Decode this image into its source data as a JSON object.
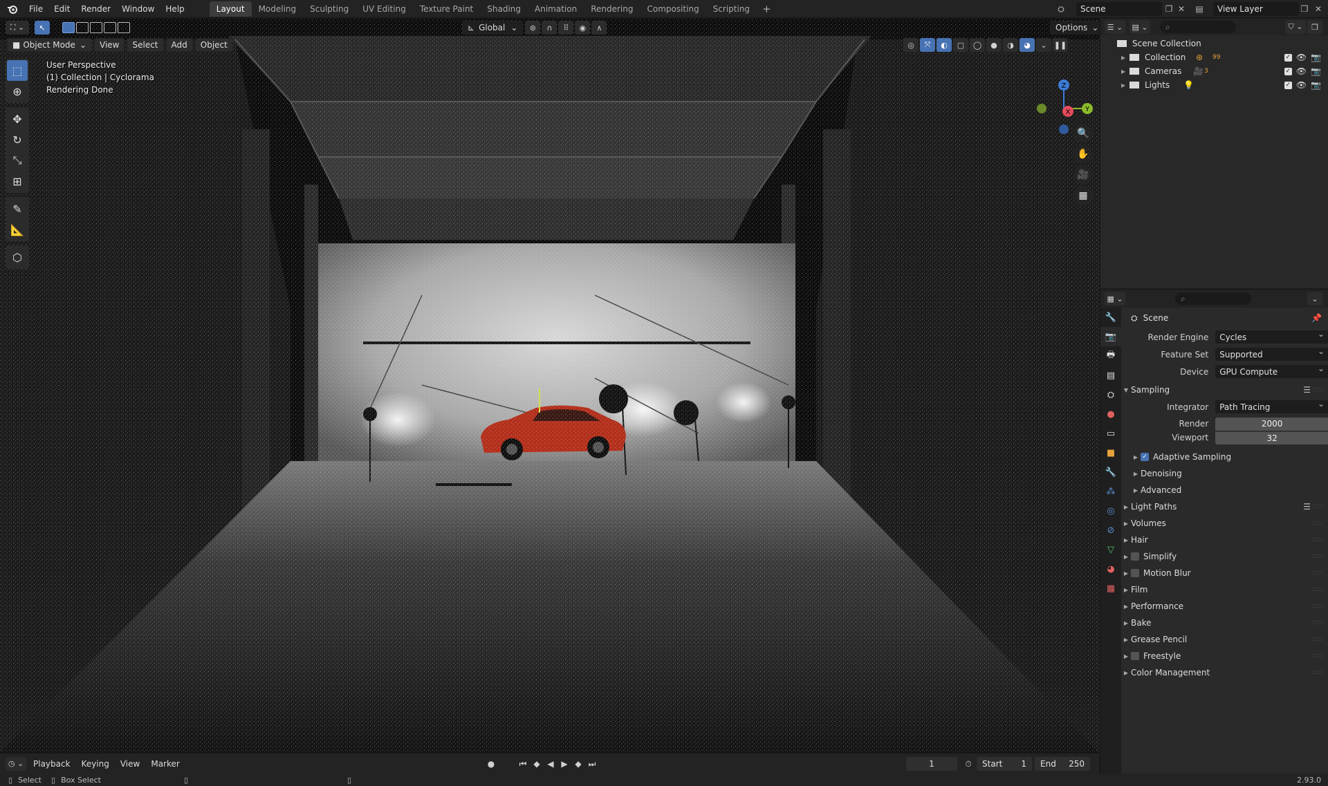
{
  "topbar": {
    "menus": [
      "File",
      "Edit",
      "Render",
      "Window",
      "Help"
    ],
    "workspaces": [
      "Layout",
      "Modeling",
      "Sculpting",
      "UV Editing",
      "Texture Paint",
      "Shading",
      "Animation",
      "Rendering",
      "Compositing",
      "Scripting"
    ],
    "active_workspace": "Layout",
    "add_tab": "+",
    "scene_name": "Scene",
    "view_layer": "View Layer"
  },
  "viewport": {
    "mode": "Object Mode",
    "menus": [
      "View",
      "Select",
      "Add",
      "Object"
    ],
    "transform_orientation": "Global",
    "options_label": "Options",
    "overlay": {
      "line1": "User Perspective",
      "line2": "(1) Collection | Cyclorama",
      "line3": "Rendering Done"
    },
    "gizmo": {
      "x": "X",
      "y": "Y",
      "z": "Z"
    },
    "tools": [
      "select-box",
      "cursor",
      "move",
      "rotate",
      "scale",
      "transform",
      "annotate",
      "measure",
      "add-cube"
    ]
  },
  "timeline": {
    "menus": [
      "Playback",
      "Keying",
      "View",
      "Marker"
    ],
    "current_frame": "1",
    "start_label": "Start",
    "start_value": "1",
    "end_label": "End",
    "end_value": "250"
  },
  "statusbar": {
    "select": "Select",
    "box_select": "Box Select",
    "version": "2.93.0"
  },
  "outliner": {
    "root": "Scene Collection",
    "items": [
      {
        "name": "Collection",
        "badge": "99"
      },
      {
        "name": "Cameras",
        "badge": "3"
      },
      {
        "name": "Lights",
        "badge": ""
      }
    ]
  },
  "properties": {
    "title": "Scene",
    "render_engine_label": "Render Engine",
    "render_engine": "Cycles",
    "feature_set_label": "Feature Set",
    "feature_set": "Supported",
    "device_label": "Device",
    "device": "GPU Compute",
    "sampling": {
      "title": "Sampling",
      "integrator_label": "Integrator",
      "integrator": "Path Tracing",
      "render_label": "Render",
      "render_value": "2000",
      "viewport_label": "Viewport",
      "viewport_value": "32",
      "sub": [
        "Adaptive Sampling",
        "Denoising",
        "Advanced"
      ]
    },
    "panels": [
      "Light Paths",
      "Volumes",
      "Hair",
      "Simplify",
      "Motion Blur",
      "Film",
      "Performance",
      "Bake",
      "Grease Pencil",
      "Freestyle",
      "Color Management"
    ]
  },
  "colors": {
    "accent": "#4772b3",
    "header_bg": "#232323",
    "panel_bg": "#2a2a2a"
  }
}
